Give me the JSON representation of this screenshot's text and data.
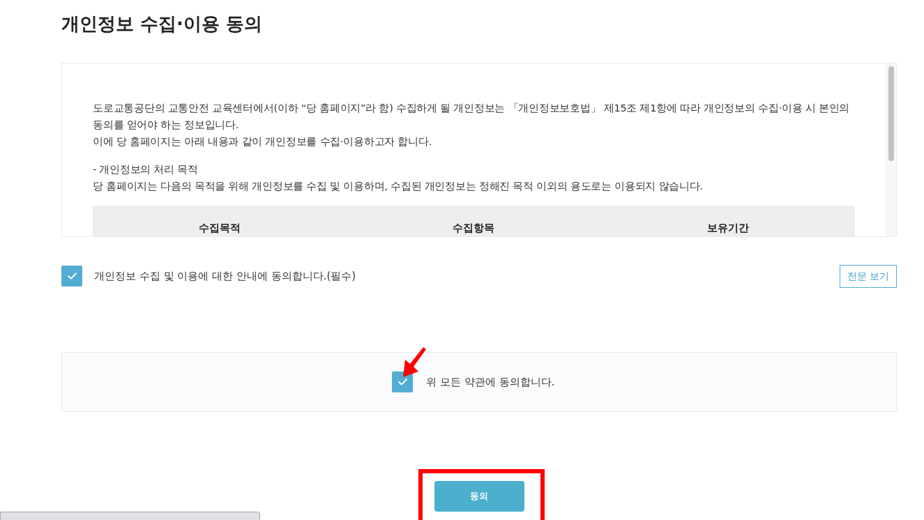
{
  "title": "개인정보 수집·이용 동의",
  "terms_box": {
    "blocks": [
      [
        "도로교통공단의 교통안전 교육센터에서(이하 “당 홈페이지”라 함) 수집하게 될 개인정보는 「개인정보보호법」 제15조 제1항에 따라 개인정보의 수집·이용 시 본인의 동의를 얻어야 하는 정보입니다.",
        "이에 당 홈페이지는 아래 내용과 같이 개인정보를 수집·이용하고자 합니다."
      ],
      [
        "- 개인정보의 처리 목적",
        "당 홈페이지는 다음의 목적을 위해 개인정보를 수집 및 이용하며, 수집된 개인정보는 정해진 목적 이외의 용도로는 이용되지 않습니다."
      ]
    ],
    "table": {
      "columns": [
        "수집목적",
        "수집항목",
        "보유기간"
      ]
    }
  },
  "consent": {
    "label": "개인정보 수집 및 이용에 대한 안내에 동의합니다.(필수)",
    "checked": true,
    "view_button": "전문 보기"
  },
  "agree_all": {
    "label": "위 모든 약관에 동의합니다.",
    "checked": true
  },
  "submit_button": "동의"
}
